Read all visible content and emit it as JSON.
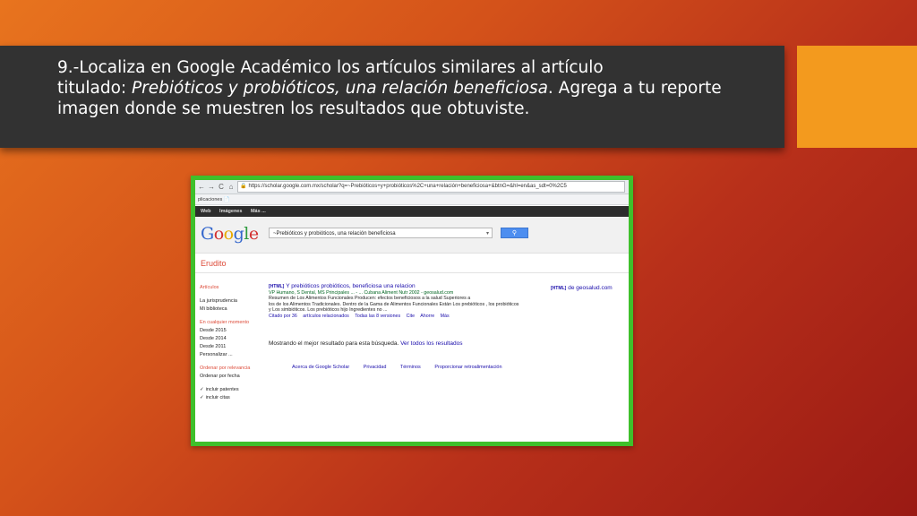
{
  "slide": {
    "title_line1": "9.-Localiza en Google Académico los artículos similares al artículo",
    "title_line2_prefix": "titulado: ",
    "title_line2_italic": "Prebióticos y probióticos, una relación beneficiosa",
    "title_line2_suffix": ". Agrega a tu reporte",
    "title_line3": "imagen donde se muestren los resultados que obtuviste.",
    "accent_color": "#f39a1e",
    "frame_color": "#3fbf2b"
  },
  "browser": {
    "back_icon": "back-arrow-icon",
    "url": "https://scholar.google.com.mx/scholar?q=~Prebióticos+y+probióticos%2C+una+relación+beneficiosa+&btnG=&hl=en&as_sdt=0%2C5",
    "bookmark": "plicaciones"
  },
  "google_bar": {
    "items": [
      "Web",
      "Imágenes",
      "Más ..."
    ]
  },
  "scholar": {
    "logo_letters": [
      "G",
      "o",
      "o",
      "g",
      "l",
      "e"
    ],
    "search_value": "~Prebióticos y probióticos, una relación beneficiosa",
    "section_label": "Erudito",
    "sidebar": {
      "group1": [
        "Artículos",
        "La jurisprudencia",
        "Mi biblioteca"
      ],
      "group2": [
        "En cualquier momento",
        "Desde 2015",
        "Desde 2014",
        "Desde 2011",
        "Personalizar ..."
      ],
      "group3": [
        "Ordenar por relevancia",
        "Ordenar por fecha"
      ],
      "group4": [
        "incluir patentes",
        "incluir citas"
      ]
    },
    "result": {
      "tag": "[HTML]",
      "title": "Y prebióticos probióticos, beneficiosa una relacion",
      "side_tag": "[HTML]",
      "side_source": "de geosalud.com",
      "authors": "VP Humano, S Dental, MS Principales ... - ... Cubana Aliment Nutr 2002 - geosalud.com",
      "snippet1": "Resumen de Los Alimentos Funcionales Producen: efectos beneficiosos a la salud Superiores a",
      "snippet2": "los de los Alimentos Tradicionales. Dentro de la Gama de Alimentos Funcionales Están Los prebióticos , los probióticos",
      "snippet3": "y Los simbióticos. Los prebióticos hijo Ingredientes no ...",
      "links": [
        "Citado por 36",
        "artículos relacionados",
        "Todas las 8 versiones",
        "Cite",
        "Ahorre",
        "Más"
      ]
    },
    "showing_text": "Mostrando el mejor resultado para esta búsqueda.",
    "showing_link": "Ver todos los resultados",
    "footer": [
      "Acerca de Google Scholar",
      "Privacidad",
      "Términos",
      "Proporcionar retroalimentación"
    ]
  }
}
